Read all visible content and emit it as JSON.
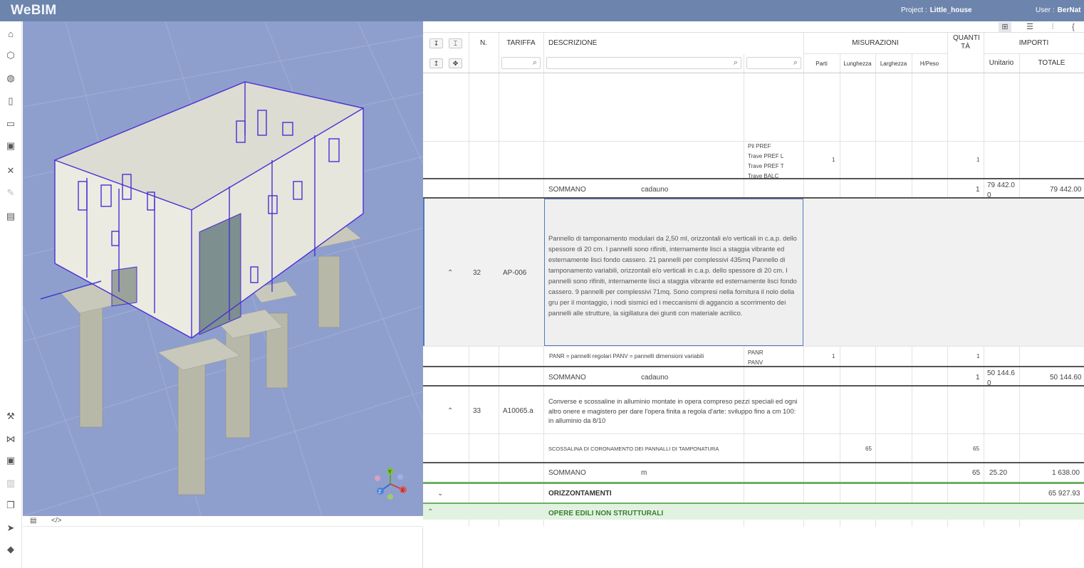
{
  "app": {
    "logo": "WeBIM",
    "project_label": "Project :",
    "project_name": "Little_house",
    "user_label": "User :",
    "user_name": "BerNat"
  },
  "sidebar_icons": [
    "building-icon",
    "cube-icon",
    "globe-icon",
    "door-icon",
    "monitor-edit-icon",
    "presentation-icon",
    "tools-icon",
    "edit-disabled-icon",
    "document-icon",
    "wrench-icon",
    "vscode-icon",
    "save-icon",
    "trash-disabled-icon",
    "copy-icon",
    "send-icon",
    "tag-icon"
  ],
  "viewer": {
    "gizmo": {
      "y": "Y",
      "x": "X",
      "z": "Z"
    }
  },
  "console": {
    "tabs": [
      "list-icon",
      "</>"
    ]
  },
  "table": {
    "headers": {
      "n": "N.",
      "tariffa": "TARIFFA",
      "descrizione": "DESCRIZIONE",
      "misurazioni": "MISURAZIONI",
      "quantita": "QUANTI TÀ",
      "importi": "IMPORTI",
      "parti": "Parti",
      "lunghezza": "Lunghezza",
      "larghezza": "Larghezza",
      "hpeso": "H/Peso",
      "unitario": "Unitario",
      "totale": "TOTALE"
    },
    "row_a": {
      "labels": [
        "Pil PREF",
        "Trave PREF L",
        "Trave PREF T",
        "Trave BALC"
      ],
      "parti": "1",
      "quantita": "1"
    },
    "sum_a": {
      "label": "SOMMANO",
      "unit": "cadauno",
      "quantita": "1",
      "unitario": "79 442.00",
      "totale": "79 442.00"
    },
    "item_32": {
      "n": "32",
      "tariffa": "AP-006",
      "descrizione": "Pannello di tamponamento modulari da 2,50 ml, orizzontali e/o verticali in c.a.p. dello spessore di 20 cm. I pannelli sono rifiniti, internamente lisci a staggia vibrante ed esternamente lisci fondo cassero. 21 pannelli per complessivi 435mq Pannello di tamponamento variabili, orizzontali e/o verticali in c.a.p. dello spessore di 20 cm. I pannelli sono rifiniti, internamente lisci a staggia vibrante ed esternamente lisci fondo cassero. 9 pannelli per complessivi 71mq. Sono compresi nella fornitura il nolo della gru per il montaggio, i nodi sismici ed i meccanismi di aggancio a scorrimento dei pannelli alle strutture, la sigillatura dei giunti con materiale acrilico.",
      "sub": "PANR = pannelli regolari PANV = pannelli dimensioni variabili",
      "labels": [
        "PANR",
        "PANV"
      ],
      "parti": "1",
      "quantita": "1"
    },
    "sum_32": {
      "label": "SOMMANO",
      "unit": "cadauno",
      "quantita": "1",
      "unitario": "50 144.60",
      "totale": "50 144.60"
    },
    "item_33": {
      "n": "33",
      "tariffa": "A10065.a",
      "descrizione": "Converse e scossaline in alluminio montate in opera compreso pezzi speciali ed ogni altro onere e magistero per dare l'opera finita a regola d'arte: sviluppo fino a cm 100: in alluminio da 8/10",
      "sub": "SCOSSALINA DI CORONAMENTO DEI PANNALLI DI TAMPONATURA",
      "lunghezza": "65",
      "quantita": "65"
    },
    "sum_33": {
      "label": "SOMMANO",
      "unit": "m",
      "quantita": "65",
      "unitario": "25.20",
      "totale": "1 638.00"
    },
    "group_1": {
      "label": "ORIZZONTAMENTI",
      "totale": "65 927.93"
    },
    "group_2": {
      "label": "OPERE EDILI NON STRUTTURALI"
    }
  },
  "colors": {
    "topbar": "#6d85ad",
    "viewer_bg": "#8f9fcd",
    "wireframe": "#4a2fd6",
    "selection": "#4f78b9",
    "green": "#6bb063"
  }
}
